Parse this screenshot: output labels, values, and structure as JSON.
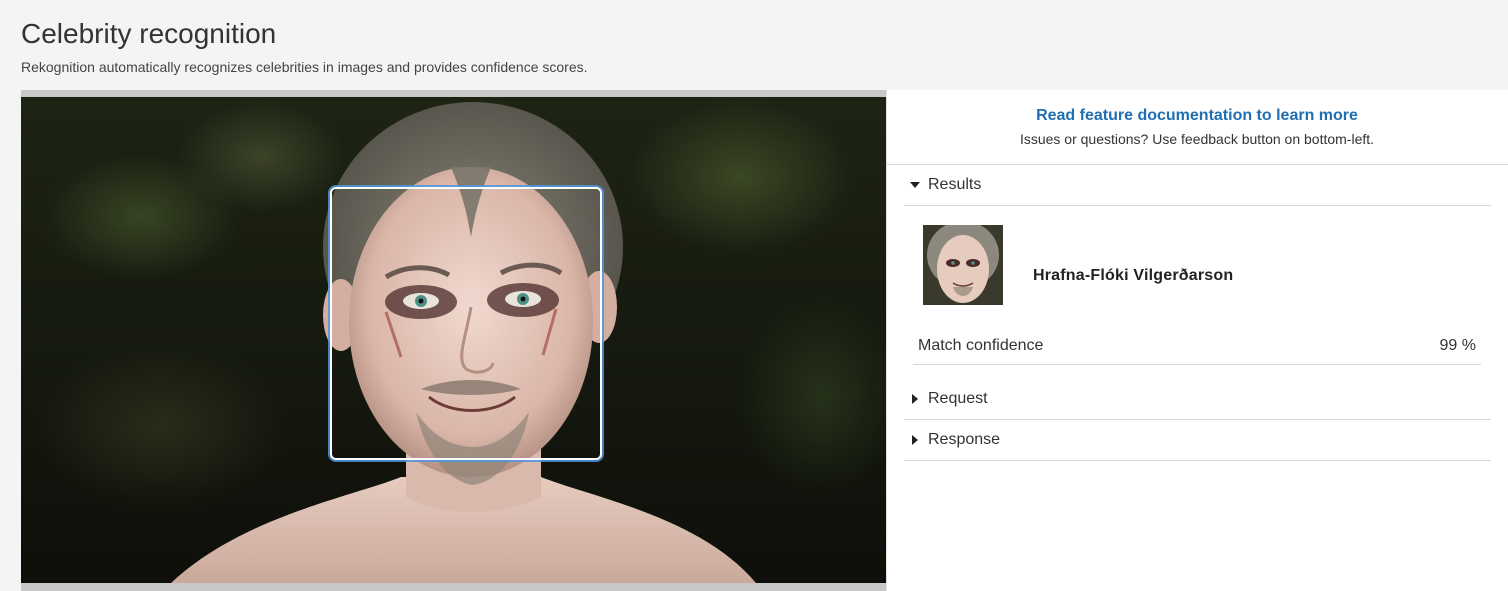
{
  "header": {
    "title": "Celebrity recognition",
    "subtitle": "Rekognition automatically recognizes celebrities in images and provides confidence scores."
  },
  "info": {
    "doc_link": "Read feature documentation to learn more",
    "note": "Issues or questions? Use feedback button on bottom-left."
  },
  "sections": {
    "results": "Results",
    "request": "Request",
    "response": "Response"
  },
  "result": {
    "name": "Hrafna-Flóki Vilgerðarson",
    "confidence_label": "Match confidence",
    "confidence_value": "99 %"
  },
  "colors": {
    "link": "#1f6fb2",
    "bbox_border": "#ffffff",
    "bbox_glow": "#5096dc"
  },
  "icons": {
    "expanded": "caret-down-icon",
    "collapsed": "caret-right-icon"
  }
}
